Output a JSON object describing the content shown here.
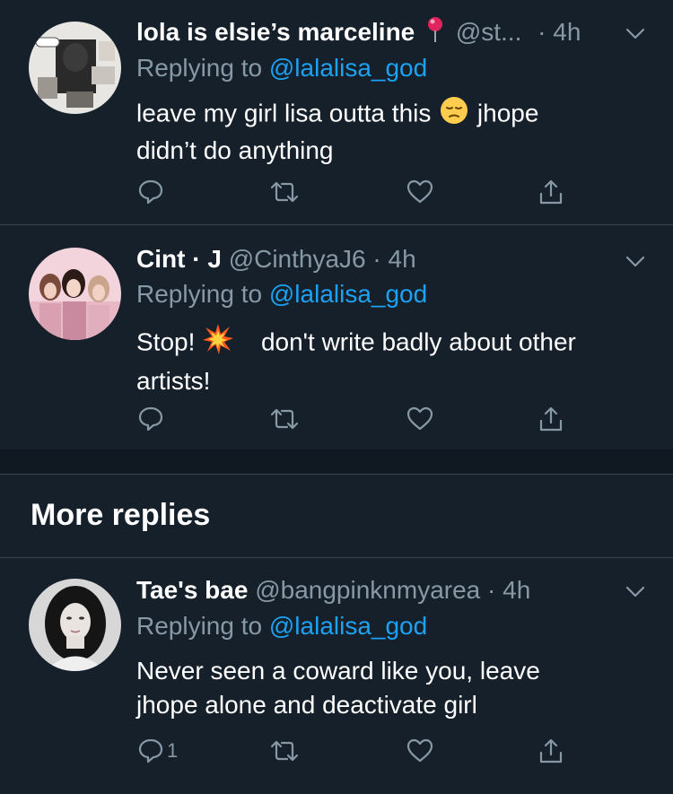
{
  "tweets": [
    {
      "name": "lola is elsie’s marceline",
      "handle": "@st...",
      "time": "· 4h",
      "replying_prefix": "Replying to ",
      "replying_to": "@lalalisa_god",
      "text_part1": "leave my girl lisa outta this",
      "text_part2": "jhope",
      "text_line2": "didn’t do anything",
      "reply_count": "",
      "avatar_icon": "collage-avatar",
      "name_emoji": "round-pushpin-emoji",
      "body_emoji": "pensive-face-emoji"
    },
    {
      "name": "Cint",
      "name_suffix": " · J",
      "handle": "@CinthyaJ6",
      "time": "· 4h",
      "replying_prefix": "Replying to ",
      "replying_to": "@lalalisa_god",
      "text_part1": "Stop!",
      "text_part2": "don't write badly about other",
      "text_line2": "artists!",
      "reply_count": "",
      "avatar_icon": "group-photo-avatar",
      "body_emoji": "collision-emoji"
    },
    {
      "name": "Tae's bae",
      "handle": "@bangpinknmyarea",
      "time": "· 4h",
      "replying_prefix": "Replying to ",
      "replying_to": "@lalalisa_god",
      "text_line1": "Never seen a coward like you, leave",
      "text_line2": "jhope alone and deactivate girl",
      "reply_count": "1",
      "avatar_icon": "portrait-avatar"
    }
  ],
  "more_replies_label": "More replies",
  "colors": {
    "background": "#15202b",
    "section_gap": "#101821",
    "divider": "#38444d",
    "secondary_text": "#8899a6",
    "link": "#1da1f2",
    "primary_text": "#ffffff"
  },
  "icons": [
    "reply-icon",
    "retweet-icon",
    "like-icon",
    "share-icon",
    "chevron-down-icon"
  ]
}
